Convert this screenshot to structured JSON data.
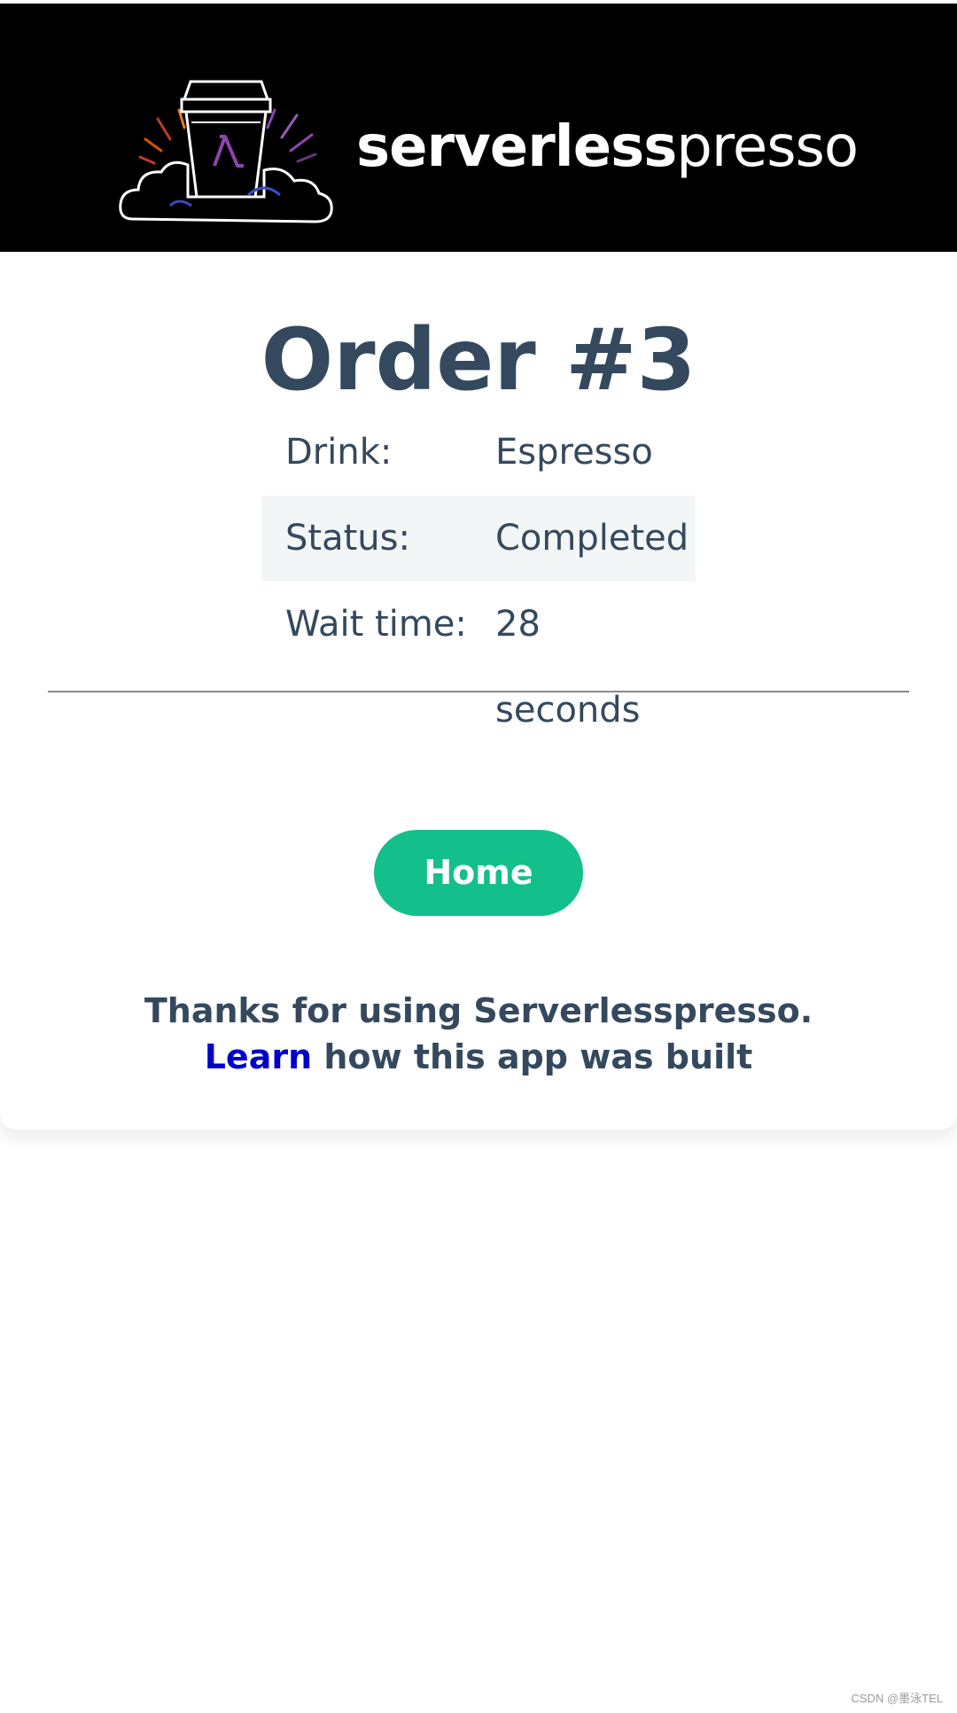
{
  "header": {
    "brand_bold": "serverless",
    "brand_light": "presso",
    "logo_icon": "coffee-cup-cloud-lambda-icon"
  },
  "order": {
    "title": "Order #3",
    "rows": [
      {
        "label": "Drink:",
        "value": "Espresso"
      },
      {
        "label": "Status:",
        "value": "Completed"
      },
      {
        "label": "Wait time:",
        "value": "28 seconds"
      }
    ]
  },
  "actions": {
    "home_label": "Home"
  },
  "footer": {
    "thanks_line": "Thanks for using Serverlesspresso.",
    "learn_link": "Learn",
    "learn_rest": " how this app was built"
  },
  "watermark": "CSDN @墨泳TEL",
  "colors": {
    "header_bg": "#000000",
    "text": "#34495e",
    "accent_green": "#13bf8b",
    "link": "#0000cc",
    "row_alt_bg": "#f3f6f7"
  }
}
